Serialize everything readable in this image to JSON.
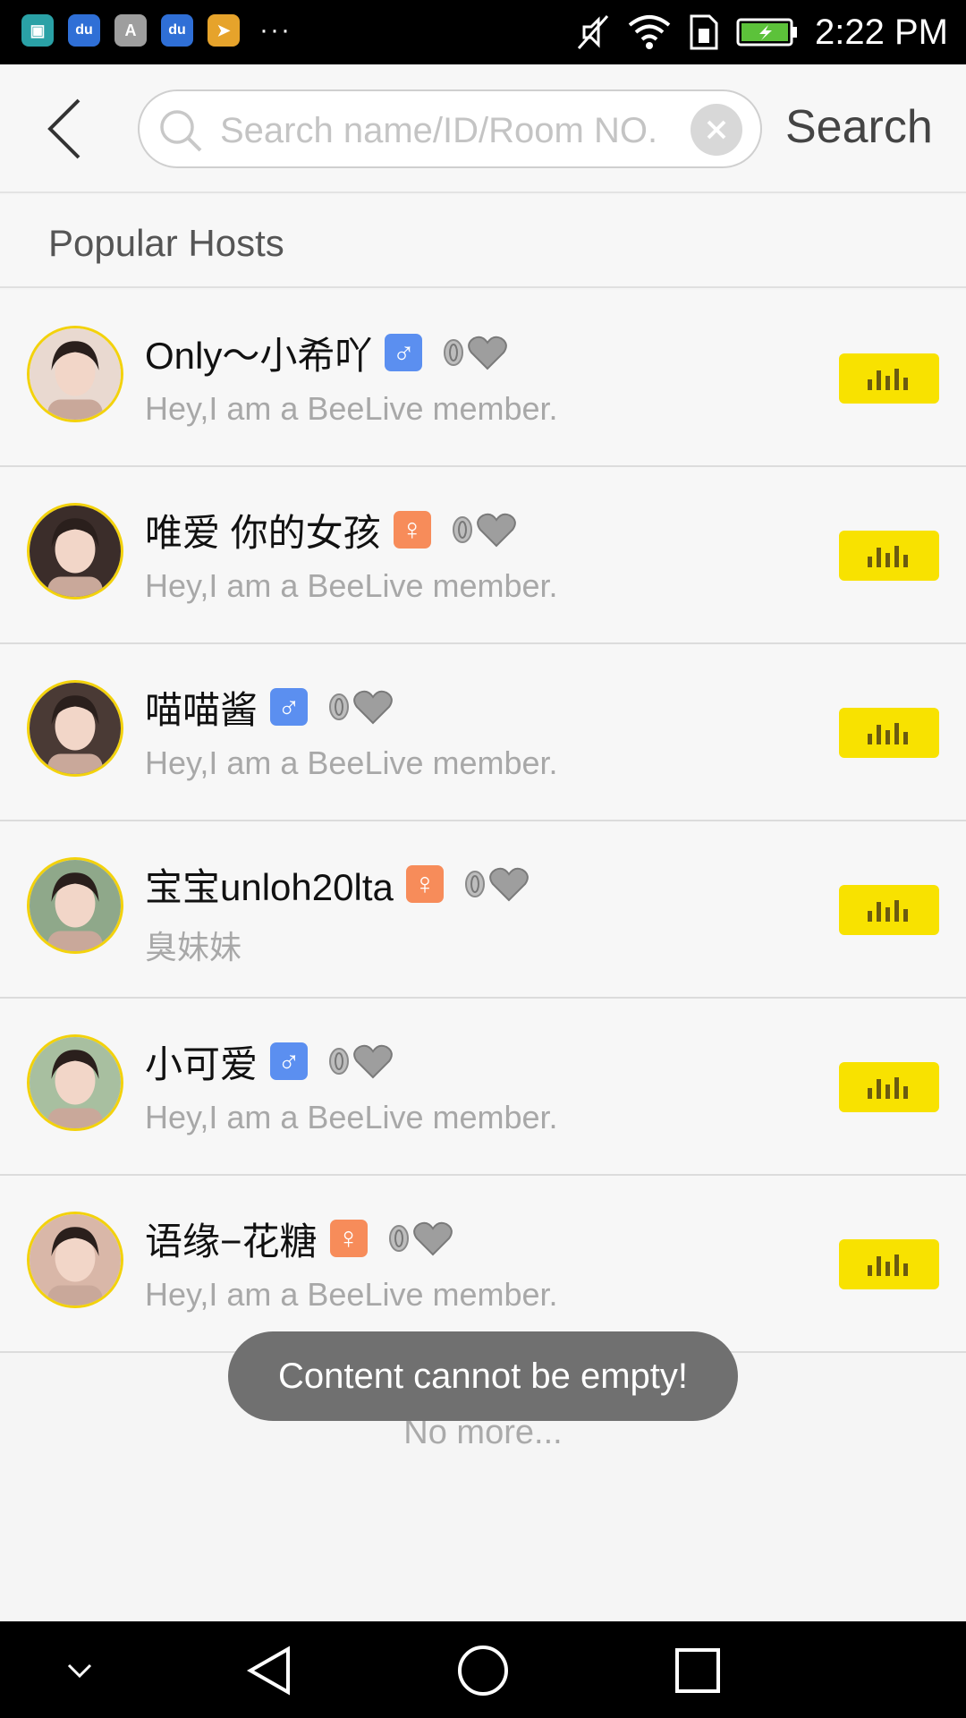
{
  "status_bar": {
    "time": "2:22 PM",
    "apps": [
      {
        "icon": "android-app-icon",
        "color": "#2aa1a6",
        "glyph": "▣"
      },
      {
        "icon": "baidu-app-icon",
        "color": "#2f6fd6",
        "glyph": "du"
      },
      {
        "icon": "font-app-icon",
        "color": "#9e9e9e",
        "glyph": "A"
      },
      {
        "icon": "baidu-app-icon-2",
        "color": "#2f6fd6",
        "glyph": "du"
      },
      {
        "icon": "telegram-app-icon",
        "color": "#e6a32b",
        "glyph": "➤"
      }
    ],
    "more": "···"
  },
  "header": {
    "search_placeholder": "Search name/ID/Room NO.",
    "search_value": "",
    "search_label": "Search"
  },
  "section": {
    "title": "Popular Hosts"
  },
  "hosts": [
    {
      "name": "Only～小希吖",
      "gender": "male",
      "bio": "Hey,I am a BeeLive member.",
      "avatar_bg": "#e9d9d0"
    },
    {
      "name": "唯爱 你的女孩",
      "gender": "female",
      "bio": "Hey,I am a BeeLive member.",
      "avatar_bg": "#3b2d2a"
    },
    {
      "name": "喵喵酱",
      "gender": "male",
      "bio": "Hey,I am a BeeLive member.",
      "avatar_bg": "#4a3a35"
    },
    {
      "name": "宝宝unloh20lta",
      "gender": "female",
      "bio": "臭妹妹",
      "avatar_bg": "#8fa88a"
    },
    {
      "name": "小可爱",
      "gender": "male",
      "bio": "Hey,I am a BeeLive member.",
      "avatar_bg": "#a8bfa0"
    },
    {
      "name": "语缘−花糖",
      "gender": "female",
      "bio": "Hey,I am a BeeLive member.",
      "avatar_bg": "#d9b7a8"
    }
  ],
  "footer": {
    "no_more": "No more..."
  },
  "toast": {
    "message": "Content cannot be empty!"
  },
  "colors": {
    "accent_yellow": "#f8e200",
    "avatar_ring": "#f3d20c",
    "male_badge": "#5b8ff0",
    "female_badge": "#f78c5a"
  }
}
